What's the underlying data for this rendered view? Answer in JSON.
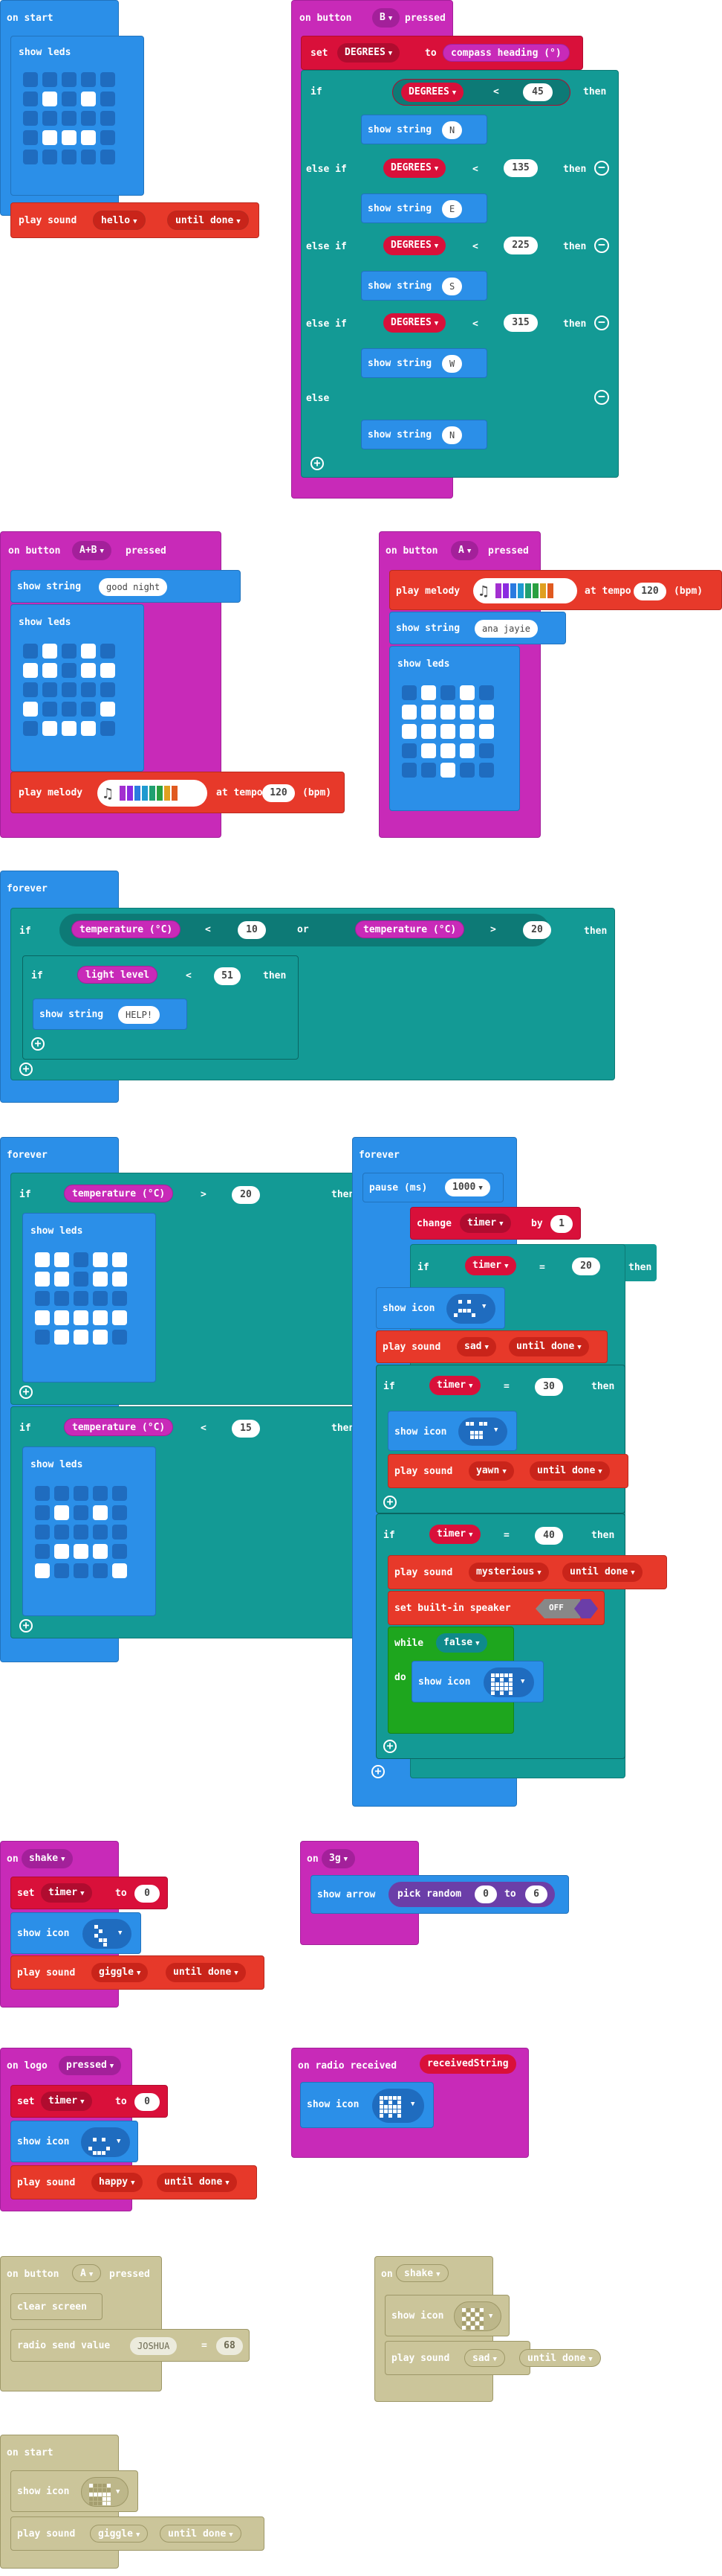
{
  "blocks": {
    "on_start": {
      "label": "on start"
    },
    "show_leds": "show leds",
    "play_sound": "play sound",
    "until_done": "until done",
    "sound_hello": "hello",
    "on_button_b": {
      "label": "on button",
      "button": "B",
      "pressed": "pressed"
    },
    "set": "set",
    "var_degrees": "DEGREES",
    "to": "to",
    "compass": "compass heading (°)",
    "if": "if",
    "else_if": "else if",
    "else": "else",
    "then": "then",
    "lt": "<",
    "gt": ">",
    "eq": "=",
    "or": "or",
    "show_string": "show string",
    "n": "N",
    "e": "E",
    "s": "S",
    "w": "W",
    "v45": "45",
    "v135": "135",
    "v225": "225",
    "v315": "315",
    "on_button_ab": {
      "button": "A+B"
    },
    "good_night": "good night",
    "play_melody": "play melody",
    "at_tempo": "at tempo",
    "tempo": "120",
    "bpm": "(bpm)",
    "on_button_a": {
      "button": "A"
    },
    "ana_jayie": "ana jayie",
    "forever": "forever",
    "temperature": "temperature (°C)",
    "t10": "10",
    "t20": "20",
    "t15": "15",
    "light_level": "light level",
    "l51": "51",
    "help": "HELP!",
    "pause": "pause (ms)",
    "pause_val": "1000",
    "change": "change",
    "var_timer": "timer",
    "by": "by",
    "one": "1",
    "show_icon": "show icon",
    "sad": "sad",
    "timer30": "30",
    "yawn": "yawn",
    "timer40": "40",
    "mysterious": "mysterious",
    "set_builtin": "set built-in speaker",
    "off": "OFF",
    "while": "while",
    "false": "false",
    "do": "do",
    "on_shake": "on",
    "shake": "shake",
    "zero": "0",
    "giggle": "giggle",
    "on_3g": "3g",
    "show_arrow": "show arrow",
    "pick_random": "pick random",
    "six": "6",
    "on_logo": "on logo",
    "logo_pressed": "pressed",
    "happy": "happy",
    "on_radio": "on radio received",
    "received_string": "receivedString",
    "clear_screen": "clear screen",
    "radio_send_value": "radio send value",
    "joshua": "JOSHUA",
    "v68": "68"
  }
}
